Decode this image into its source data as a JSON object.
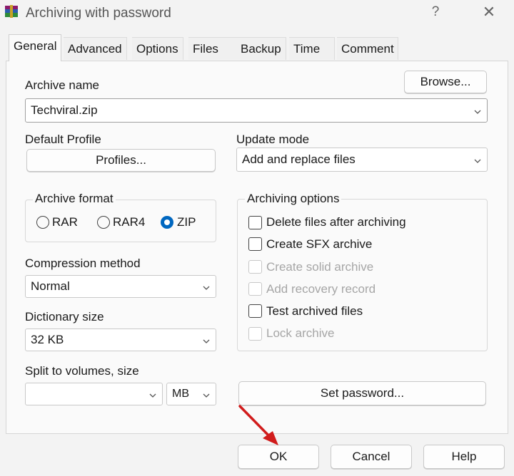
{
  "window": {
    "title": "Archiving with password",
    "help_glyph": "?",
    "close_glyph": "✕"
  },
  "tabs": [
    "General",
    "Advanced",
    "Options",
    "Files",
    "Backup",
    "Time",
    "Comment"
  ],
  "general": {
    "archive_name_label": "Archive name",
    "browse_label": "Browse...",
    "archive_name_value": "Techviral.zip",
    "default_profile_label": "Default Profile",
    "profiles_label": "Profiles...",
    "update_mode_label": "Update mode",
    "update_mode_value": "Add and replace files",
    "archive_format": {
      "title": "Archive format",
      "options": [
        "RAR",
        "RAR4",
        "ZIP"
      ],
      "selected": "ZIP"
    },
    "compression_method_label": "Compression method",
    "compression_method_value": "Normal",
    "dictionary_size_label": "Dictionary size",
    "dictionary_size_value": "32 KB",
    "split_label": "Split to volumes, size",
    "split_value": "",
    "split_unit": "MB",
    "archiving_options": {
      "title": "Archiving options",
      "items": [
        {
          "label": "Delete files after archiving",
          "checked": false,
          "enabled": true
        },
        {
          "label": "Create SFX archive",
          "checked": false,
          "enabled": true
        },
        {
          "label": "Create solid archive",
          "checked": false,
          "enabled": false
        },
        {
          "label": "Add recovery record",
          "checked": false,
          "enabled": false
        },
        {
          "label": "Test archived files",
          "checked": false,
          "enabled": true
        },
        {
          "label": "Lock archive",
          "checked": false,
          "enabled": false
        }
      ]
    },
    "set_password_label": "Set password..."
  },
  "footer": {
    "ok": "OK",
    "cancel": "Cancel",
    "help": "Help"
  },
  "colors": {
    "accent": "#0067c0",
    "arrow": "#d11c1c"
  }
}
